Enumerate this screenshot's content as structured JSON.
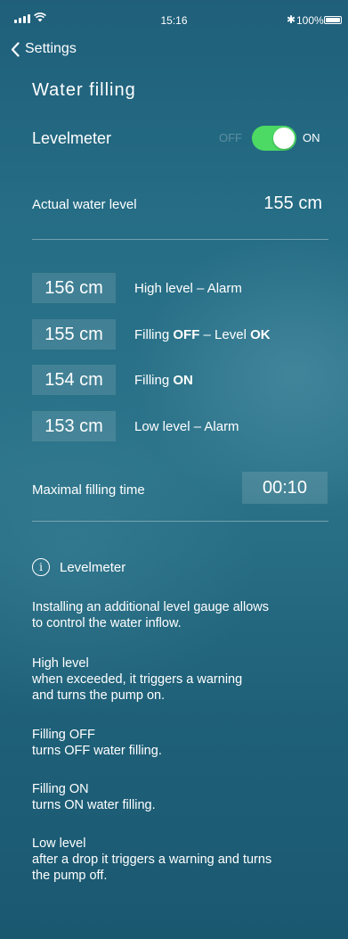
{
  "status_bar": {
    "time": "15:16",
    "battery": "100%",
    "bluetooth": "✱"
  },
  "nav": {
    "back_label": "Settings"
  },
  "page": {
    "title": "Water filling"
  },
  "levelmeter": {
    "label": "Levelmeter",
    "off_label": "OFF",
    "on_label": "ON",
    "enabled": true
  },
  "actual": {
    "label": "Actual water level",
    "value": "155 cm"
  },
  "levels": [
    {
      "value": "156 cm",
      "parts": [
        "High level – Alarm"
      ]
    },
    {
      "value": "155 cm",
      "parts": [
        "Filling ",
        "OFF",
        " – Level ",
        "OK"
      ]
    },
    {
      "value": "154 cm",
      "parts": [
        "Filling ",
        "ON"
      ]
    },
    {
      "value": "153 cm",
      "parts": [
        "Low level – Alarm"
      ]
    }
  ],
  "max_fill": {
    "label": "Maximal filling time",
    "value": "00:10"
  },
  "info": {
    "title": "Levelmeter",
    "icon": "i",
    "intro": [
      "Installing an additional level gauge allows",
      "to control the water inflow."
    ],
    "items": [
      {
        "heading": "High level",
        "lines": [
          "when exceeded, it triggers a warning",
          "and turns the pump on."
        ]
      },
      {
        "heading": "Filling OFF",
        "lines": [
          "turns OFF water filling."
        ]
      },
      {
        "heading": "Filling ON",
        "lines": [
          "turns ON water filling."
        ]
      },
      {
        "heading": "Low level",
        "lines": [
          "after a drop it triggers a warning  and turns",
          "the pump off."
        ]
      }
    ]
  }
}
